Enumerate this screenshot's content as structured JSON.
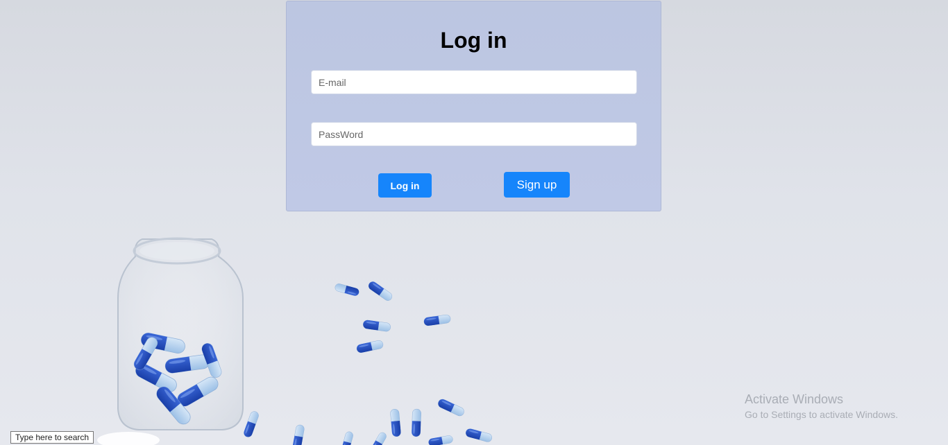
{
  "login": {
    "title": "Log in",
    "email_placeholder": "E-mail",
    "password_placeholder": "PassWord",
    "login_button": "Log in",
    "signup_button": "Sign up"
  },
  "watermark": {
    "title": "Activate Windows",
    "subtitle": "Go to Settings to activate Windows."
  },
  "taskbar": {
    "search_tooltip": "Type here to search"
  },
  "colors": {
    "accent": "#1685fb",
    "card": "#bec7e3"
  }
}
